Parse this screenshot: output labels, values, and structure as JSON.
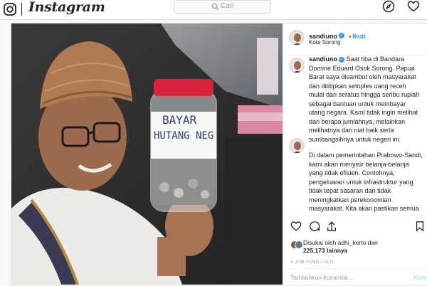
{
  "brand": {
    "name": "Instagram"
  },
  "search": {
    "placeholder": "Cari"
  },
  "nav": {
    "icons": [
      "compass-icon",
      "heart-icon"
    ]
  },
  "post": {
    "username": "sandiuno",
    "verified": "✓",
    "follow_dot": "•",
    "follow_label": "Ikuti",
    "location": "Kota Sorong",
    "caption_user": "sandiuno",
    "caption_para1": "Saat tiba di Bandara Domine Eduard Osok Sorong, Papua Barat saya disambut oleh masyarakat dan dititipkan setoples uang receh mulai dari seratus hingga seribu rupiah sebagai bantuan untuk membayar utang negara. Kami tidak ingin melihat dari berapa jumlahnya, melainkan melihatnya dari niat baik serta sumbangsihnya untuk negeri ini.",
    "caption_para2": "Di dalam pemerintahan Prabowo-Sandi, kami akan menyisir belanja-belanja yang tidak efisien. Contohnya, pengeluaran untuk infrastruktur yang tidak tepat sasaran dan tidak meningkatkan perekonomian masyarakat. Kita akan pastikan semua uang yang keluar dari rakyat, akan terasa dampaknya langsung untuk masyarakat khususnya dalam",
    "jar_line1": "BAYAR",
    "jar_line2": "HUTANG NEG",
    "likes_line1": "Disukai oleh adhi_kerto dan",
    "likes_line2": "225.173 lainnya",
    "time": "4 JAM YANG LALU",
    "comment_placeholder": "Tambahkan komentar...",
    "post_button": "Kirim"
  },
  "colors": {
    "accent": "#3897f0",
    "border": "#dbdbdb",
    "text": "#262626",
    "muted": "#999999"
  }
}
